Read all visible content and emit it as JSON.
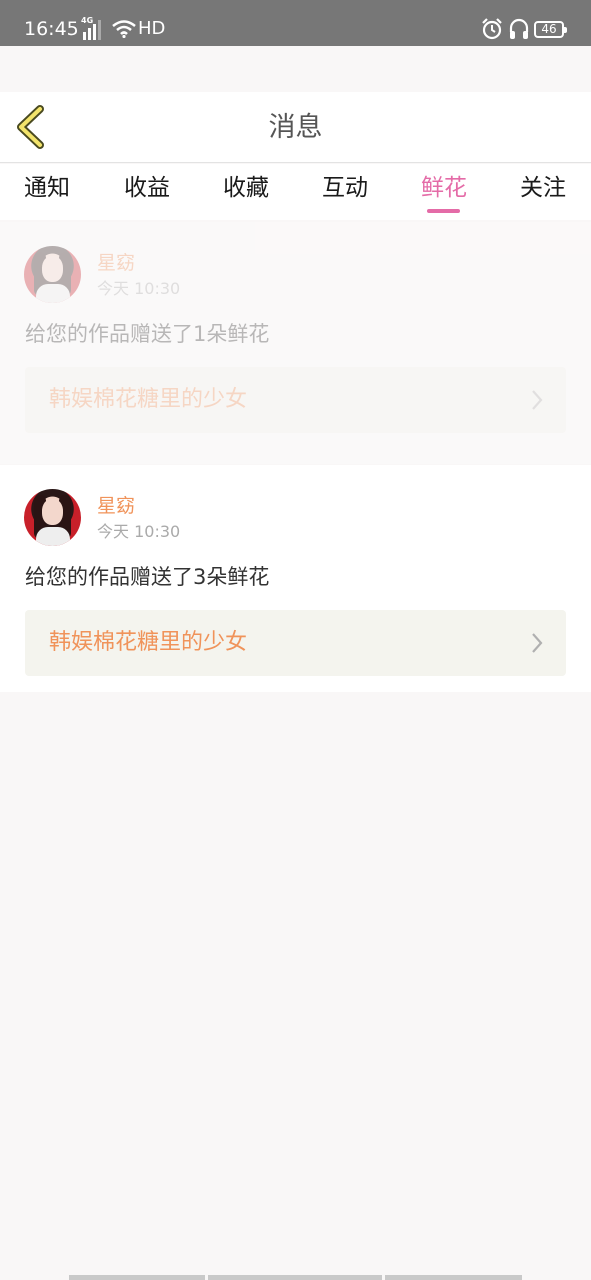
{
  "status_bar": {
    "time": "16:45",
    "network": "4G",
    "hd": "HD",
    "battery": "46"
  },
  "header": {
    "title": "消息"
  },
  "tabs": [
    {
      "label": "通知",
      "active": false
    },
    {
      "label": "收益",
      "active": false
    },
    {
      "label": "收藏",
      "active": false
    },
    {
      "label": "互动",
      "active": false
    },
    {
      "label": "鲜花",
      "active": true
    },
    {
      "label": "关注",
      "active": false
    }
  ],
  "messages": [
    {
      "user": "星窈",
      "time": "今天 10:30",
      "text": "给您的作品赠送了1朵鲜花",
      "work_title": "韩娱棉花糖里的少女"
    },
    {
      "user": "星窈",
      "time": "今天 10:30",
      "text": "给您的作品赠送了3朵鲜花",
      "work_title": "韩娱棉花糖里的少女"
    }
  ],
  "colors": {
    "accent_pink": "#e46ba7",
    "name_orange": "#f0935a",
    "status_bar": "#777777",
    "page_background": "#f9f7f7"
  }
}
